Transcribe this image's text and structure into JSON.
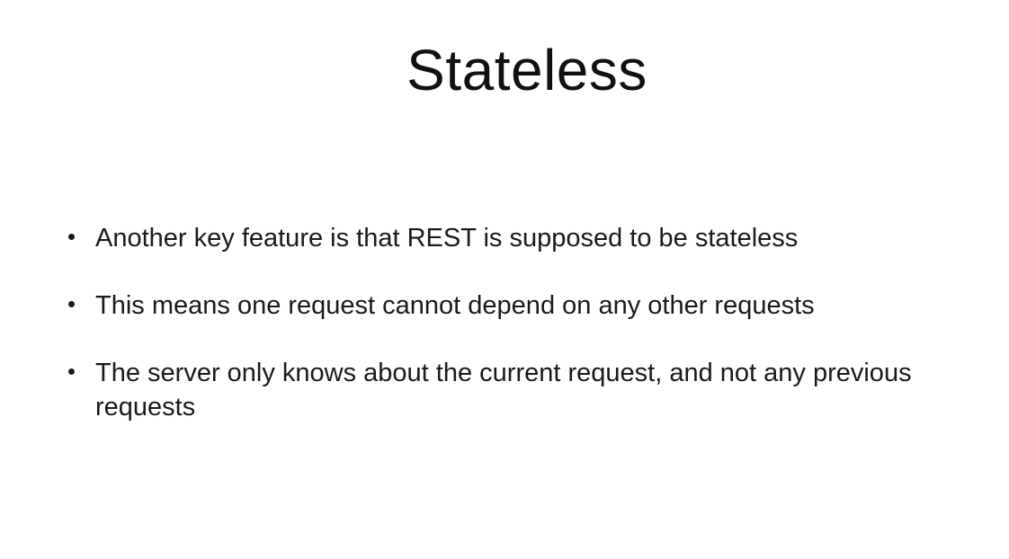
{
  "slide": {
    "title": "Stateless",
    "bullets": [
      "Another key feature is that REST is supposed to be stateless",
      "This means one request cannot depend on any other requests",
      "The server only knows about the current request, and not any previous requests"
    ]
  }
}
